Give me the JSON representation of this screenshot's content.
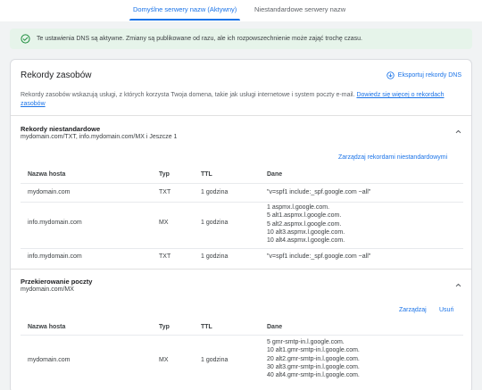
{
  "tabs": [
    {
      "label": "Domyślne serwery nazw (Aktywny)",
      "active": true
    },
    {
      "label": "Niestandardowe serwery nazw",
      "active": false
    }
  ],
  "banner": {
    "text": "Te ustawienia DNS są aktywne. Zmiany są publikowane od razu, ale ich rozpowszechnienie może zająć trochę czasu.",
    "icon": "check-circle-icon",
    "color": "#e6f4ea"
  },
  "card": {
    "title": "Rekordy zasobów",
    "export_label": "Eksportuj rekordy DNS",
    "description": "Rekordy zasobów wskazują usługi, z których korzysta Twoja domena, takie jak usługi internetowe i system poczty e-mail.",
    "learn_more": "Dowiedz się więcej o rekordach zasobów"
  },
  "custom_records": {
    "title": "Rekordy niestandardowe",
    "subtitle": "mydomain.com/TXT, info.mydomain.com/MX i Jeszcze 1",
    "manage_label": "Zarządzaj rekordami niestandardowymi",
    "columns": [
      "Nazwa hosta",
      "Typ",
      "TTL",
      "Dane"
    ],
    "rows": [
      {
        "host": "mydomain.com",
        "type": "TXT",
        "ttl": "1 godzina",
        "data": [
          "\"v=spf1 include:_spf.google.com ~all\""
        ]
      },
      {
        "host": "info.mydomain.com",
        "type": "MX",
        "ttl": "1 godzina",
        "data": [
          "1 aspmx.l.google.com.",
          "5 alt1.aspmx.l.google.com.",
          "5 alt2.aspmx.l.google.com.",
          "10 alt3.aspmx.l.google.com.",
          "10 alt4.aspmx.l.google.com."
        ]
      },
      {
        "host": "info.mydomain.com",
        "type": "TXT",
        "ttl": "1 godzina",
        "data": [
          "\"v=spf1 include:_spf.google.com ~all\""
        ]
      }
    ]
  },
  "mail_forwarding": {
    "title": "Przekierowanie poczty",
    "subtitle": "mydomain.com/MX",
    "manage_label": "Zarządzaj",
    "delete_label": "Usuń",
    "columns": [
      "Nazwa hosta",
      "Typ",
      "TTL",
      "Dane"
    ],
    "rows": [
      {
        "host": "mydomain.com",
        "type": "MX",
        "ttl": "1 godzina",
        "data": [
          "5 gmr-smtp-in.l.google.com.",
          "10 alt1.gmr-smtp-in.l.google.com.",
          "20 alt2.gmr-smtp-in.l.google.com.",
          "30 alt3.gmr-smtp-in.l.google.com.",
          "40 alt4.gmr-smtp-in.l.google.com."
        ]
      }
    ]
  },
  "colors": {
    "accent": "#1a73e8",
    "success": "#1e8e3e"
  }
}
